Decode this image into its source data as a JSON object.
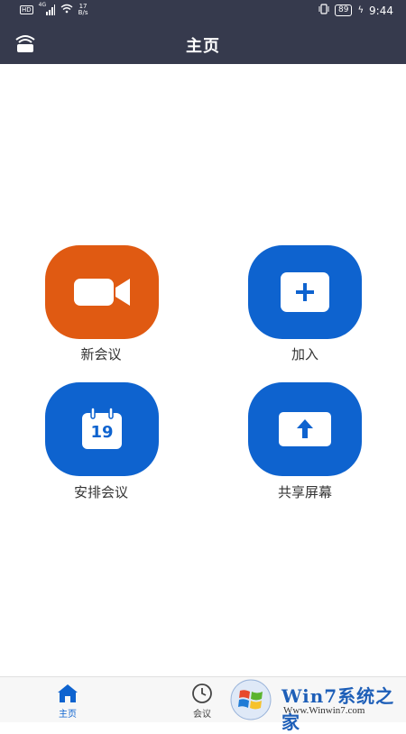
{
  "status_bar": {
    "network_badge": "HD",
    "signal_type": "4G",
    "speed_value": "17",
    "speed_unit": "B/s",
    "battery": "89",
    "time": "9:44"
  },
  "header": {
    "title": "主页"
  },
  "actions": [
    {
      "label": "新会议",
      "icon": "video-camera-icon",
      "color": "#e05a12"
    },
    {
      "label": "加入",
      "icon": "plus-icon",
      "color": "#0e63cf"
    },
    {
      "label": "安排会议",
      "icon": "calendar-icon",
      "icon_text": "19",
      "color": "#0e63cf"
    },
    {
      "label": "共享屏幕",
      "icon": "share-upload-icon",
      "color": "#0e63cf"
    }
  ],
  "tabbar": {
    "tabs": [
      {
        "label": "主页",
        "icon": "home-icon",
        "active": true
      },
      {
        "label": "会议",
        "icon": "clock-icon",
        "active": false
      }
    ]
  },
  "watermark": {
    "brand": "Win7系统之家",
    "url": "Www.Winwin7.com"
  },
  "colors": {
    "header_bg": "#363a4d",
    "accent": "#0e63cf",
    "orange": "#e05a12"
  }
}
